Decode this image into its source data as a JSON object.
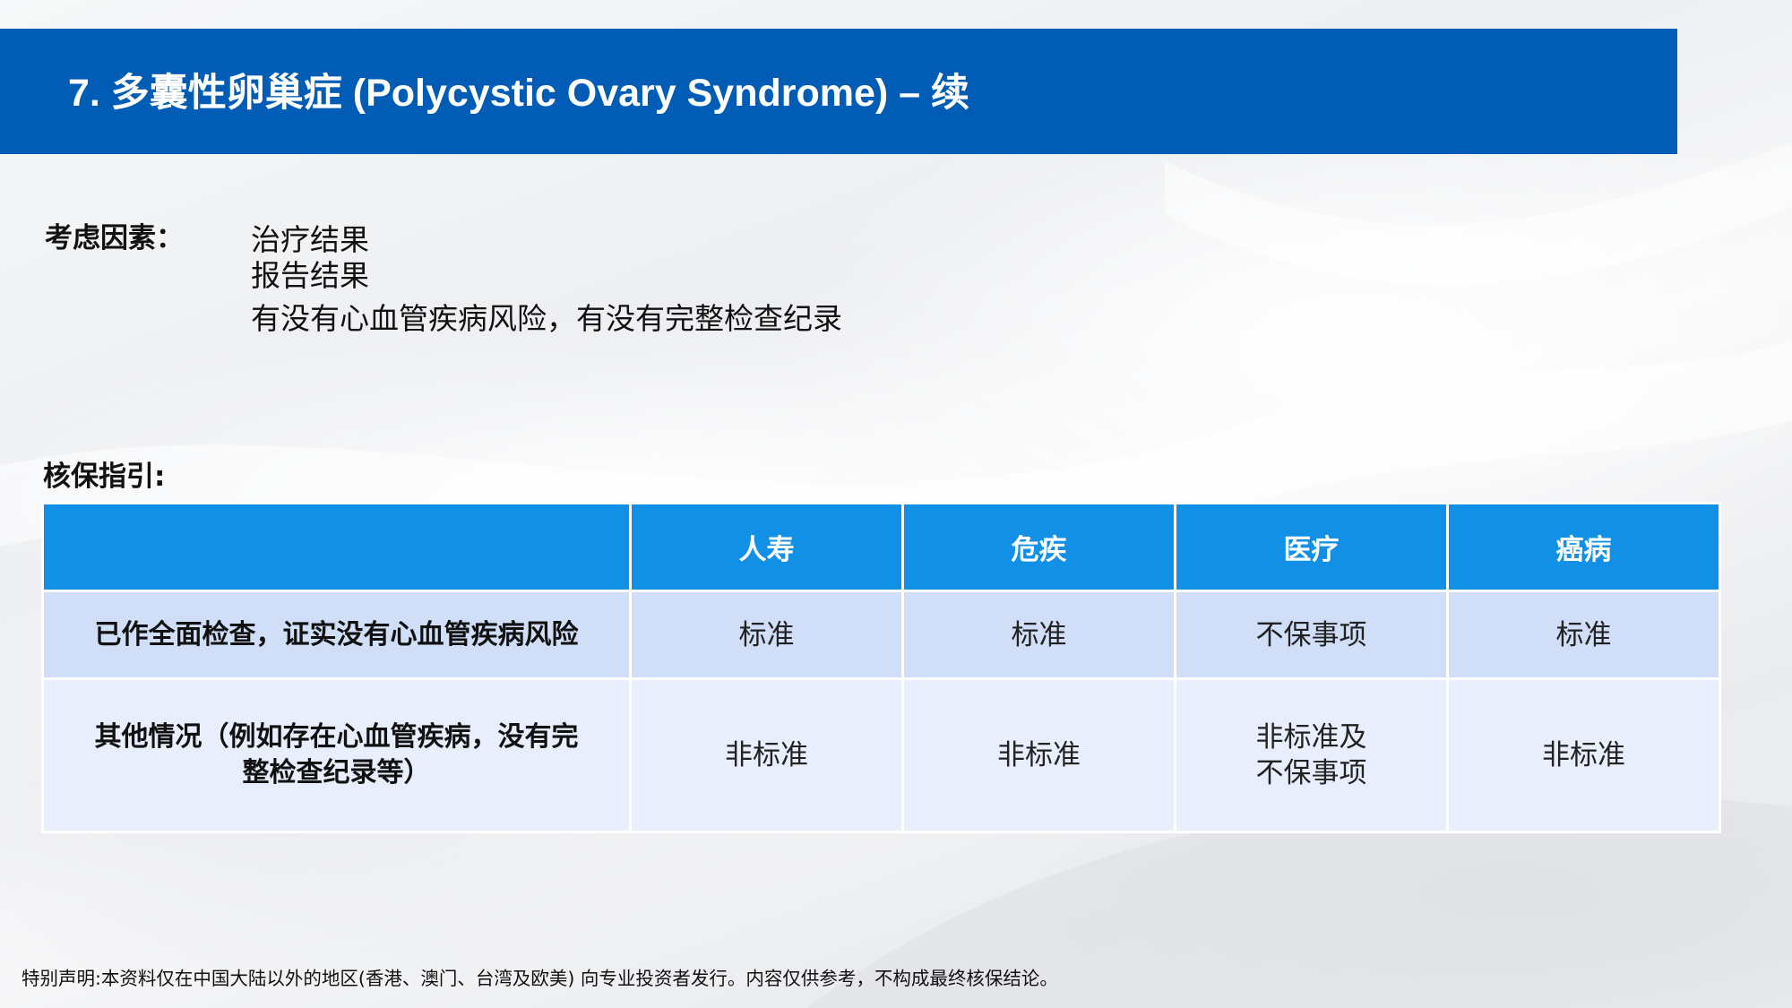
{
  "header": {
    "title": "7. 多囊性卵巢症 (Polycystic Ovary Syndrome) – 续",
    "bar_color": "#005cb4"
  },
  "factors": {
    "label": "考虑因素：",
    "items": [
      "治疗结果",
      "报告结果",
      "有没有心血管疾病风险，有没有完整检查纪录"
    ]
  },
  "guidance": {
    "label": "核保指引:",
    "table": {
      "header_color": "#1290e6",
      "columns": [
        "",
        "人寿",
        "危疾",
        "医疗",
        "癌病"
      ],
      "rows": [
        {
          "condition": "已作全面检查，证实没有心血管疾病风险",
          "values": [
            "标准",
            "标准",
            "不保事项",
            "标准"
          ]
        },
        {
          "condition_line1": "其他情况（例如存在心血管疾病，没有完",
          "condition_line2": "整检查纪录等）",
          "values": [
            "非标准",
            "非标准",
            "非标准及",
            "非标准"
          ],
          "medical_line2": "不保事项"
        }
      ]
    }
  },
  "footer": {
    "disclaimer": "特别声明:本资料仅在中国大陆以外的地区(香港、澳门、台湾及欧美) 向专业投资者发行。内容仅供参考，不构成最终核保结论。"
  }
}
